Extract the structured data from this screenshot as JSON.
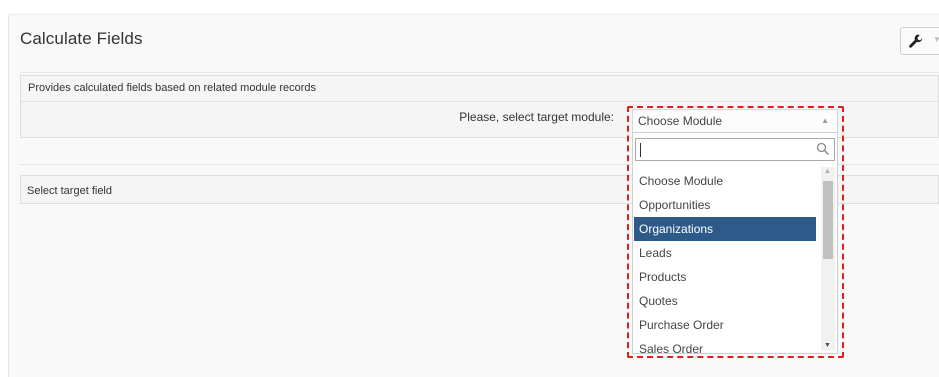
{
  "page": {
    "title": "Calculate Fields",
    "description": "Provides calculated fields based on related module records",
    "target_module_label": "Please, select target module:",
    "select_target_field_label": "Select target field"
  },
  "toolbar": {
    "settings_icon": "wrench-icon",
    "dropdown_icon": "caret-down-icon"
  },
  "module_select": {
    "selected_value": "Choose Module",
    "search_value": "",
    "search_icon": "search-icon",
    "highlight_color": "#e01e1e",
    "selected_option_color": "#2e5a8a",
    "options": [
      {
        "label": "Choose Module",
        "selected": false
      },
      {
        "label": "Opportunities",
        "selected": false
      },
      {
        "label": "Organizations",
        "selected": true
      },
      {
        "label": "Leads",
        "selected": false
      },
      {
        "label": "Products",
        "selected": false
      },
      {
        "label": "Quotes",
        "selected": false
      },
      {
        "label": "Purchase Order",
        "selected": false
      },
      {
        "label": "Sales Order",
        "selected": false
      }
    ]
  }
}
